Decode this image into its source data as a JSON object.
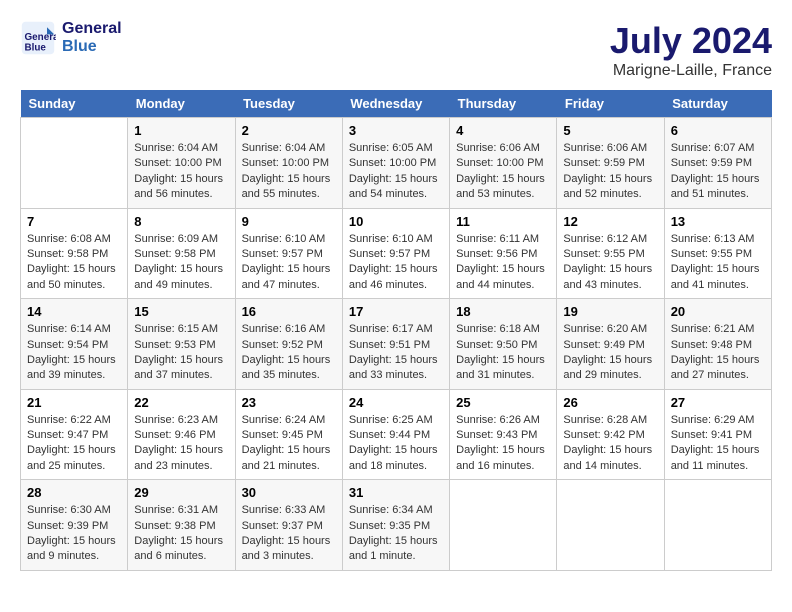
{
  "header": {
    "logo_line1": "General",
    "logo_line2": "Blue",
    "month_year": "July 2024",
    "location": "Marigne-Laille, France"
  },
  "calendar": {
    "days_of_week": [
      "Sunday",
      "Monday",
      "Tuesday",
      "Wednesday",
      "Thursday",
      "Friday",
      "Saturday"
    ],
    "weeks": [
      [
        {
          "day": "",
          "info": ""
        },
        {
          "day": "1",
          "info": "Sunrise: 6:04 AM\nSunset: 10:00 PM\nDaylight: 15 hours\nand 56 minutes."
        },
        {
          "day": "2",
          "info": "Sunrise: 6:04 AM\nSunset: 10:00 PM\nDaylight: 15 hours\nand 55 minutes."
        },
        {
          "day": "3",
          "info": "Sunrise: 6:05 AM\nSunset: 10:00 PM\nDaylight: 15 hours\nand 54 minutes."
        },
        {
          "day": "4",
          "info": "Sunrise: 6:06 AM\nSunset: 10:00 PM\nDaylight: 15 hours\nand 53 minutes."
        },
        {
          "day": "5",
          "info": "Sunrise: 6:06 AM\nSunset: 9:59 PM\nDaylight: 15 hours\nand 52 minutes."
        },
        {
          "day": "6",
          "info": "Sunrise: 6:07 AM\nSunset: 9:59 PM\nDaylight: 15 hours\nand 51 minutes."
        }
      ],
      [
        {
          "day": "7",
          "info": "Sunrise: 6:08 AM\nSunset: 9:58 PM\nDaylight: 15 hours\nand 50 minutes."
        },
        {
          "day": "8",
          "info": "Sunrise: 6:09 AM\nSunset: 9:58 PM\nDaylight: 15 hours\nand 49 minutes."
        },
        {
          "day": "9",
          "info": "Sunrise: 6:10 AM\nSunset: 9:57 PM\nDaylight: 15 hours\nand 47 minutes."
        },
        {
          "day": "10",
          "info": "Sunrise: 6:10 AM\nSunset: 9:57 PM\nDaylight: 15 hours\nand 46 minutes."
        },
        {
          "day": "11",
          "info": "Sunrise: 6:11 AM\nSunset: 9:56 PM\nDaylight: 15 hours\nand 44 minutes."
        },
        {
          "day": "12",
          "info": "Sunrise: 6:12 AM\nSunset: 9:55 PM\nDaylight: 15 hours\nand 43 minutes."
        },
        {
          "day": "13",
          "info": "Sunrise: 6:13 AM\nSunset: 9:55 PM\nDaylight: 15 hours\nand 41 minutes."
        }
      ],
      [
        {
          "day": "14",
          "info": "Sunrise: 6:14 AM\nSunset: 9:54 PM\nDaylight: 15 hours\nand 39 minutes."
        },
        {
          "day": "15",
          "info": "Sunrise: 6:15 AM\nSunset: 9:53 PM\nDaylight: 15 hours\nand 37 minutes."
        },
        {
          "day": "16",
          "info": "Sunrise: 6:16 AM\nSunset: 9:52 PM\nDaylight: 15 hours\nand 35 minutes."
        },
        {
          "day": "17",
          "info": "Sunrise: 6:17 AM\nSunset: 9:51 PM\nDaylight: 15 hours\nand 33 minutes."
        },
        {
          "day": "18",
          "info": "Sunrise: 6:18 AM\nSunset: 9:50 PM\nDaylight: 15 hours\nand 31 minutes."
        },
        {
          "day": "19",
          "info": "Sunrise: 6:20 AM\nSunset: 9:49 PM\nDaylight: 15 hours\nand 29 minutes."
        },
        {
          "day": "20",
          "info": "Sunrise: 6:21 AM\nSunset: 9:48 PM\nDaylight: 15 hours\nand 27 minutes."
        }
      ],
      [
        {
          "day": "21",
          "info": "Sunrise: 6:22 AM\nSunset: 9:47 PM\nDaylight: 15 hours\nand 25 minutes."
        },
        {
          "day": "22",
          "info": "Sunrise: 6:23 AM\nSunset: 9:46 PM\nDaylight: 15 hours\nand 23 minutes."
        },
        {
          "day": "23",
          "info": "Sunrise: 6:24 AM\nSunset: 9:45 PM\nDaylight: 15 hours\nand 21 minutes."
        },
        {
          "day": "24",
          "info": "Sunrise: 6:25 AM\nSunset: 9:44 PM\nDaylight: 15 hours\nand 18 minutes."
        },
        {
          "day": "25",
          "info": "Sunrise: 6:26 AM\nSunset: 9:43 PM\nDaylight: 15 hours\nand 16 minutes."
        },
        {
          "day": "26",
          "info": "Sunrise: 6:28 AM\nSunset: 9:42 PM\nDaylight: 15 hours\nand 14 minutes."
        },
        {
          "day": "27",
          "info": "Sunrise: 6:29 AM\nSunset: 9:41 PM\nDaylight: 15 hours\nand 11 minutes."
        }
      ],
      [
        {
          "day": "28",
          "info": "Sunrise: 6:30 AM\nSunset: 9:39 PM\nDaylight: 15 hours\nand 9 minutes."
        },
        {
          "day": "29",
          "info": "Sunrise: 6:31 AM\nSunset: 9:38 PM\nDaylight: 15 hours\nand 6 minutes."
        },
        {
          "day": "30",
          "info": "Sunrise: 6:33 AM\nSunset: 9:37 PM\nDaylight: 15 hours\nand 3 minutes."
        },
        {
          "day": "31",
          "info": "Sunrise: 6:34 AM\nSunset: 9:35 PM\nDaylight: 15 hours\nand 1 minute."
        },
        {
          "day": "",
          "info": ""
        },
        {
          "day": "",
          "info": ""
        },
        {
          "day": "",
          "info": ""
        }
      ]
    ]
  }
}
